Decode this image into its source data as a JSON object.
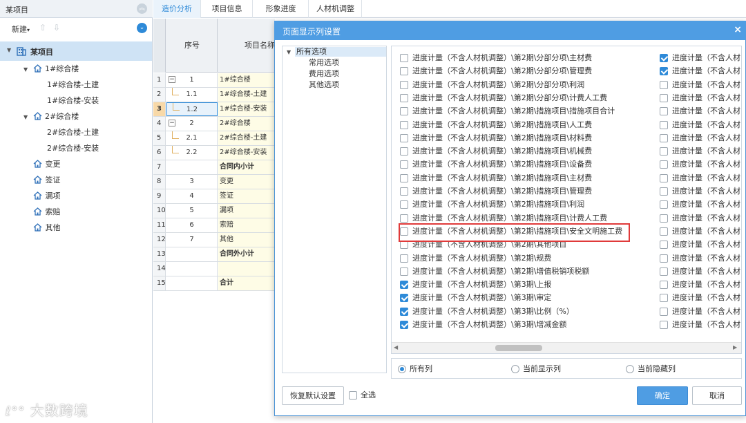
{
  "left_panel": {
    "title": "某项目",
    "new_label": "新建",
    "tree": {
      "root": "某项目",
      "items": [
        {
          "label": "1#综合楼",
          "level": 1,
          "expandable": true
        },
        {
          "label": "1#综合楼-土建",
          "level": 2,
          "expandable": false
        },
        {
          "label": "1#综合楼-安装",
          "level": 2,
          "expandable": false
        },
        {
          "label": "2#综合楼",
          "level": 1,
          "expandable": true
        },
        {
          "label": "2#综合楼-土建",
          "level": 2,
          "expandable": false
        },
        {
          "label": "2#综合楼-安装",
          "level": 2,
          "expandable": false
        },
        {
          "label": "变更",
          "level": 1,
          "expandable": false
        },
        {
          "label": "签证",
          "level": 1,
          "expandable": false
        },
        {
          "label": "漏项",
          "level": 1,
          "expandable": false
        },
        {
          "label": "索赔",
          "level": 1,
          "expandable": false
        },
        {
          "label": "其他",
          "level": 1,
          "expandable": false
        }
      ]
    }
  },
  "tabs": [
    "造价分析",
    "项目信息",
    "形象进度",
    "人材机调整"
  ],
  "active_tab": "造价分析",
  "grid": {
    "headers": {
      "seq": "序号",
      "name": "项目名称"
    },
    "rows": [
      {
        "n": "1",
        "seq": "1",
        "name": "1#综合楼",
        "bold": false,
        "tree": "minus"
      },
      {
        "n": "2",
        "seq": "1.1",
        "name": "1#综合楼-土建",
        "bold": false,
        "tree": "child"
      },
      {
        "n": "3",
        "seq": "1.2",
        "name": "1#综合楼-安装",
        "bold": false,
        "tree": "child",
        "selected": true
      },
      {
        "n": "4",
        "seq": "2",
        "name": "2#综合楼",
        "bold": false,
        "tree": "minus"
      },
      {
        "n": "5",
        "seq": "2.1",
        "name": "2#综合楼-土建",
        "bold": false,
        "tree": "child"
      },
      {
        "n": "6",
        "seq": "2.2",
        "name": "2#综合楼-安装",
        "bold": false,
        "tree": "child"
      },
      {
        "n": "7",
        "seq": "",
        "name": "合同内小计",
        "bold": true
      },
      {
        "n": "8",
        "seq": "3",
        "name": "变更",
        "bold": false
      },
      {
        "n": "9",
        "seq": "4",
        "name": "签证",
        "bold": false
      },
      {
        "n": "10",
        "seq": "5",
        "name": "漏项",
        "bold": false
      },
      {
        "n": "11",
        "seq": "6",
        "name": "索赔",
        "bold": false
      },
      {
        "n": "12",
        "seq": "7",
        "name": "其他",
        "bold": false
      },
      {
        "n": "13",
        "seq": "",
        "name": "合同外小计",
        "bold": true
      },
      {
        "n": "14",
        "seq": "",
        "name": "",
        "bold": false
      },
      {
        "n": "15",
        "seq": "",
        "name": "合计",
        "bold": true
      }
    ]
  },
  "dialog": {
    "title": "页面显示列设置",
    "close": "×",
    "option_tree": [
      "所有选项",
      "常用选项",
      "费用选项",
      "其他选项"
    ],
    "columns_left": [
      {
        "label": "进度计量（不含人材机调整）\\第2期\\分部分项\\主材费",
        "checked": false
      },
      {
        "label": "进度计量（不含人材机调整）\\第2期\\分部分项\\管理费",
        "checked": false
      },
      {
        "label": "进度计量（不含人材机调整）\\第2期\\分部分项\\利润",
        "checked": false
      },
      {
        "label": "进度计量（不含人材机调整）\\第2期\\分部分项\\计费人工费",
        "checked": false
      },
      {
        "label": "进度计量（不含人材机调整）\\第2期\\措施项目\\措施项目合计",
        "checked": false
      },
      {
        "label": "进度计量（不含人材机调整）\\第2期\\措施项目\\人工费",
        "checked": false
      },
      {
        "label": "进度计量（不含人材机调整）\\第2期\\措施项目\\材料费",
        "checked": false
      },
      {
        "label": "进度计量（不含人材机调整）\\第2期\\措施项目\\机械费",
        "checked": false
      },
      {
        "label": "进度计量（不含人材机调整）\\第2期\\措施项目\\设备费",
        "checked": false
      },
      {
        "label": "进度计量（不含人材机调整）\\第2期\\措施项目\\主材费",
        "checked": false
      },
      {
        "label": "进度计量（不含人材机调整）\\第2期\\措施项目\\管理费",
        "checked": false
      },
      {
        "label": "进度计量（不含人材机调整）\\第2期\\措施项目\\利润",
        "checked": false
      },
      {
        "label": "进度计量（不含人材机调整）\\第2期\\措施项目\\计费人工费",
        "checked": false
      },
      {
        "label": "进度计量（不含人材机调整）\\第2期\\措施项目\\安全文明施工费",
        "checked": false
      },
      {
        "label": "进度计量（不含人材机调整）\\第2期\\其他项目",
        "checked": false
      },
      {
        "label": "进度计量（不含人材机调整）\\第2期\\规费",
        "checked": false
      },
      {
        "label": "进度计量（不含人材机调整）\\第2期\\增值税销项税额",
        "checked": false
      },
      {
        "label": "进度计量（不含人材机调整）\\第3期\\上报",
        "checked": true
      },
      {
        "label": "进度计量（不含人材机调整）\\第3期\\审定",
        "checked": true
      },
      {
        "label": "进度计量（不含人材机调整）\\第3期\\比例（%）",
        "checked": true
      },
      {
        "label": "进度计量（不含人材机调整）\\第3期\\增减金额",
        "checked": true
      }
    ],
    "columns_right": [
      {
        "label": "进度计量（不含人材",
        "checked": true
      },
      {
        "label": "进度计量（不含人材",
        "checked": true
      },
      {
        "label": "进度计量（不含人材",
        "checked": false
      },
      {
        "label": "进度计量（不含人材",
        "checked": false
      },
      {
        "label": "进度计量（不含人材",
        "checked": false
      },
      {
        "label": "进度计量（不含人材",
        "checked": false
      },
      {
        "label": "进度计量（不含人材",
        "checked": false
      },
      {
        "label": "进度计量（不含人材",
        "checked": false
      },
      {
        "label": "进度计量（不含人材",
        "checked": false
      },
      {
        "label": "进度计量（不含人材",
        "checked": false
      },
      {
        "label": "进度计量（不含人材",
        "checked": false
      },
      {
        "label": "进度计量（不含人材",
        "checked": false
      },
      {
        "label": "进度计量（不含人材",
        "checked": false
      },
      {
        "label": "进度计量（不含人材",
        "checked": false
      },
      {
        "label": "进度计量（不含人材",
        "checked": false
      },
      {
        "label": "进度计量（不含人材",
        "checked": false
      },
      {
        "label": "进度计量（不含人材",
        "checked": false
      },
      {
        "label": "进度计量（不含人材",
        "checked": false
      },
      {
        "label": "进度计量（不含人材",
        "checked": false
      },
      {
        "label": "进度计量（不含人材",
        "checked": false
      },
      {
        "label": "进度计量（不含人材",
        "checked": false
      }
    ],
    "filter": {
      "options": [
        "所有列",
        "当前显示列",
        "当前隐藏列"
      ],
      "selected": "所有列"
    },
    "restore_label": "恢复默认设置",
    "select_all_label": "全选",
    "ok_label": "确定",
    "cancel_label": "取消",
    "accent": "#4f9de3",
    "highlight_color": "#e03a3a"
  },
  "watermark": "大数跨境"
}
